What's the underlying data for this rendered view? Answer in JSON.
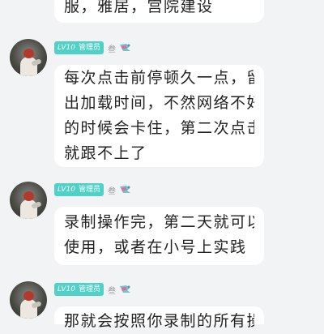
{
  "top_message": {
    "lines": [
      "服，雅居，宫院建设"
    ]
  },
  "messages": [
    {
      "badge_level": "LV10",
      "badge_role": "管理员",
      "username": "叁",
      "lines": [
        "每次点击前停顿久一点，留",
        "出加载时间，不然网络不好",
        "的时候会卡住，第二次点击",
        "就跟不上了"
      ]
    },
    {
      "badge_level": "LV10",
      "badge_role": "管理员",
      "username": "叁",
      "lines": [
        "录制操作完，第二天就可以",
        "使用，或者在小号上实践"
      ]
    },
    {
      "badge_level": "LV10",
      "badge_role": "管理员",
      "username": "叁",
      "lines": [
        "那就会按照你录制的所有操"
      ]
    }
  ],
  "colors": {
    "background": "#f2f3f5",
    "bubble": "#ffffff",
    "badge": "#4fd1c5",
    "text": "#222222",
    "username": "#9a9a9a"
  },
  "icons": {
    "avatar": "avatar-image",
    "user_tag": "flag-icon"
  }
}
